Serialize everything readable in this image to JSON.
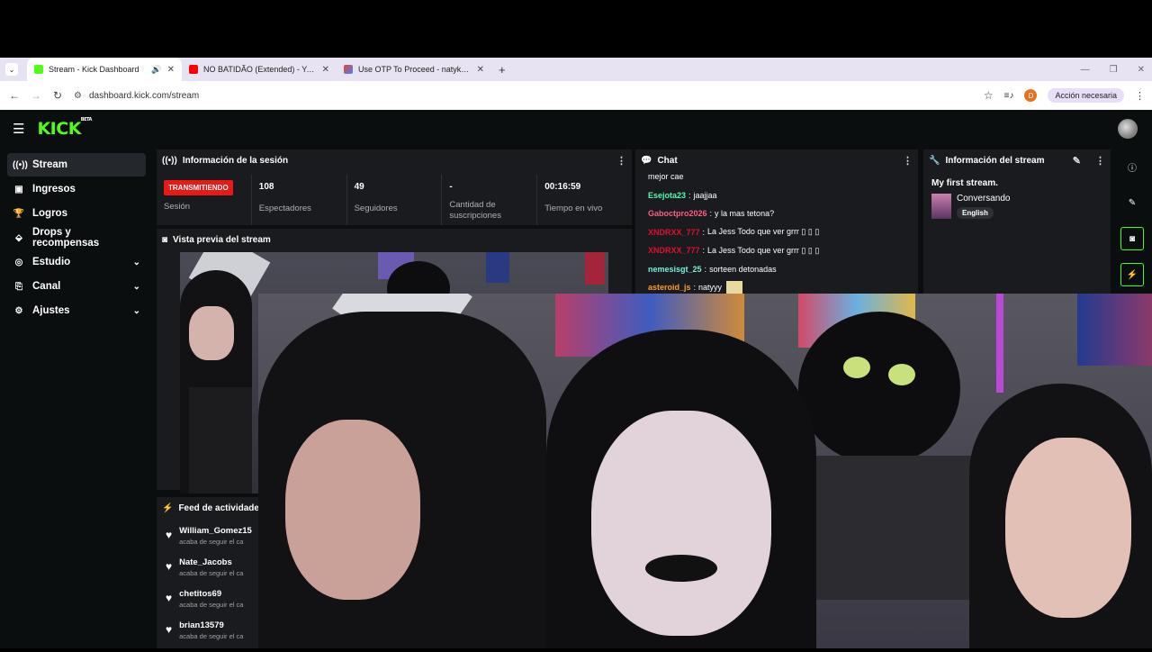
{
  "browser": {
    "tabs": [
      {
        "title": "Stream - Kick Dashboard",
        "active": true,
        "favicon_color": "#53fc18"
      },
      {
        "title": "NO BATIDÃO (Extended) - YouTube",
        "active": false,
        "favicon_color": "#ff0000"
      },
      {
        "title": "Use OTP To Proceed - natykooki",
        "active": false,
        "favicon_color": "#ea4335"
      }
    ],
    "url": "dashboard.kick.com/stream",
    "profile_initial": "D",
    "action_label": "Acción necesaria"
  },
  "kick": {
    "logo": "KICK",
    "logo_badge": "BETA",
    "accent": "#53fc18"
  },
  "sidebar": {
    "items": [
      {
        "label": "Stream",
        "icon": "stream-icon",
        "active": true
      },
      {
        "label": "Ingresos",
        "icon": "revenue-icon"
      },
      {
        "label": "Logros",
        "icon": "trophy-icon"
      },
      {
        "label": "Drops y recompensas",
        "icon": "drops-icon"
      },
      {
        "label": "Estudio",
        "icon": "studio-icon",
        "expandable": true
      },
      {
        "label": "Canal",
        "icon": "channel-icon",
        "expandable": true
      },
      {
        "label": "Ajustes",
        "icon": "settings-icon",
        "expandable": true
      }
    ]
  },
  "session": {
    "title": "Información de la sesión",
    "live_badge": "TRANSMITIENDO",
    "session_label": "Sesión",
    "stats": [
      {
        "value": "108",
        "label": "Espectadores"
      },
      {
        "value": "49",
        "label": "Seguidores"
      },
      {
        "value": "-",
        "label": "Cantidad de suscripciones"
      },
      {
        "value": "00:16:59",
        "label": "Tiempo en vivo"
      }
    ]
  },
  "preview": {
    "title": "Vista previa del stream"
  },
  "chat": {
    "title": "Chat",
    "messages": [
      {
        "user": "",
        "text": "mejor cae",
        "color": "#ffffff"
      },
      {
        "user": "Esejota23",
        "text": "jaajjaa",
        "color": "#53fcb0"
      },
      {
        "user": "Gaboctpro2026",
        "text": "y la mas tetona?",
        "color": "#ff5d7e"
      },
      {
        "user": "XNDRXX_777",
        "text": "La Jess Todo que ver grrr ▯ ▯ ▯",
        "color": "#e0102e"
      },
      {
        "user": "XNDRXX_777",
        "text": "La Jess Todo que ver grrr ▯ ▯ ▯",
        "color": "#e0102e"
      },
      {
        "user": "nemesisgt_25",
        "text": "sorteen detonadas",
        "color": "#7bf0d6"
      },
      {
        "user": "asteroid_js",
        "text": "natyyy",
        "color": "#ff9a2e"
      }
    ]
  },
  "stream_info": {
    "title": "Información del stream",
    "stream_title": "My first stream.",
    "category": "Conversando",
    "language": "English"
  },
  "activity": {
    "title": "Feed de actividades",
    "items": [
      {
        "name": "William_Gomez15",
        "sub": "acaba de seguir el ca"
      },
      {
        "name": "Nate_Jacobs",
        "sub": "acaba de seguir el ca"
      },
      {
        "name": "chetitos69",
        "sub": "acaba de seguir el ca"
      },
      {
        "name": "brian13579",
        "sub": "acaba de seguir el ca"
      }
    ]
  }
}
